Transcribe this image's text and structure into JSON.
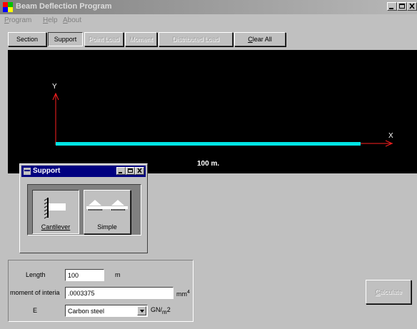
{
  "window": {
    "title": "Beam Deflection Program",
    "icon": "beam-app-icon"
  },
  "menu": [
    "Program",
    "Help",
    "About"
  ],
  "toolbar": {
    "section": "Section",
    "support": "Support",
    "point_load": "Point Load",
    "moment": "Moment",
    "distributed_load": "Distributed Load",
    "clear_all": "Clear All"
  },
  "canvas": {
    "y_label": "Y",
    "x_label": "X",
    "beam_length_label": "100 m.",
    "beam_color": "#00e5e5",
    "axis_color": "#ff0000",
    "background": "#000000"
  },
  "support_window": {
    "title": "Support",
    "cantilever": "Cantilever",
    "simple": "Simple",
    "selected": "Cantilever"
  },
  "inputs": {
    "length_label": "Length",
    "length_value": "100",
    "length_unit": "m",
    "moi_label": "moment of interia",
    "moi_value": ".0003375",
    "moi_unit": "mm",
    "moi_unit_exp": "4",
    "e_label": "E",
    "e_value": "Carbon steel",
    "e_unit_a": "GN/",
    "e_unit_m": "m",
    "e_unit_exp": "2"
  },
  "calculate": "Calculate"
}
